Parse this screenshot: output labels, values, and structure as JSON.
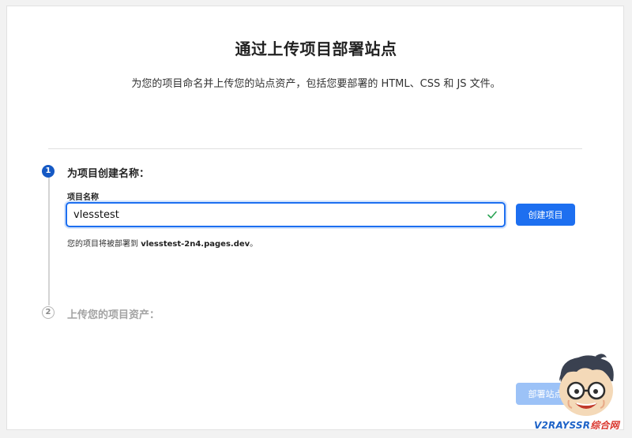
{
  "page": {
    "title": "通过上传项目部署站点",
    "subtitle": "为您的项目命名并上传您的站点资产，包括您要部署的 HTML、CSS 和 JS 文件。"
  },
  "steps": [
    {
      "number": "1",
      "title": "为项目创建名称：",
      "state": "active"
    },
    {
      "number": "2",
      "title": "上传您的项目资产：",
      "state": "inactive"
    }
  ],
  "project_name": {
    "label": "项目名称",
    "value": "vlesstest",
    "valid": true
  },
  "create_button": {
    "label": "创建项目"
  },
  "hint": {
    "prefix": "您的项目将被部署到",
    "domain": "vlesstest-2n4.pages.dev",
    "suffix": "。"
  },
  "deploy_button": {
    "label": "部署站点",
    "enabled": false
  },
  "watermark": {
    "latin": "V2RAYSSR",
    "cn": "综合网"
  },
  "colors": {
    "accent": "#1d6ff0",
    "step_active": "#1559c4",
    "valid_check": "#2aa353",
    "disabled_button": "#9cc2f7"
  },
  "icons": {
    "valid": "check-icon"
  }
}
